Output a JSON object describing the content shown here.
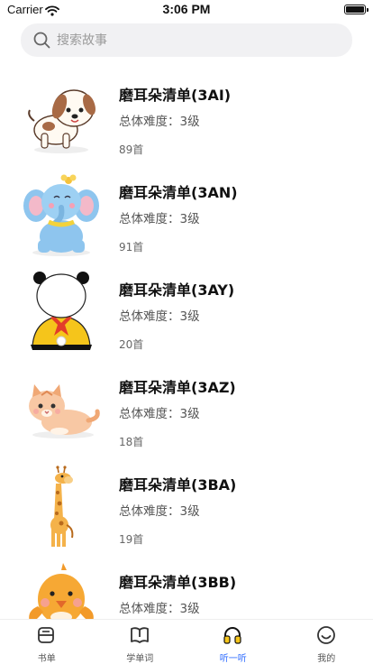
{
  "status_bar": {
    "carrier": "Carrier",
    "time": "3:06 PM"
  },
  "search": {
    "placeholder": "搜索故事",
    "value": ""
  },
  "stories": [
    {
      "title": "磨耳朵清单(3AI)",
      "difficulty": "总体难度：3级",
      "count": "89首",
      "thumbnail": "puppy"
    },
    {
      "title": "磨耳朵清单(3AN)",
      "difficulty": "总体难度：3级",
      "count": "91首",
      "thumbnail": "elephant"
    },
    {
      "title": "磨耳朵清单(3AY)",
      "difficulty": "总体难度：3级",
      "count": "20首",
      "thumbnail": "panda"
    },
    {
      "title": "磨耳朵清单(3AZ)",
      "difficulty": "总体难度：3级",
      "count": "18首",
      "thumbnail": "cat"
    },
    {
      "title": "磨耳朵清单(3BA)",
      "difficulty": "总体难度：3级",
      "count": "19首",
      "thumbnail": "giraffe"
    },
    {
      "title": "磨耳朵清单(3BB)",
      "difficulty": "总体难度：3级",
      "count": "",
      "thumbnail": "bird"
    }
  ],
  "tabs": [
    {
      "label": "书单",
      "icon": "booklist-icon",
      "active": false
    },
    {
      "label": "学单词",
      "icon": "book-icon",
      "active": false
    },
    {
      "label": "听一听",
      "icon": "headphones-icon",
      "active": true
    },
    {
      "label": "我的",
      "icon": "smiley-icon",
      "active": false
    }
  ],
  "colors": {
    "accent": "#2d6bff",
    "search_bg": "#f1f1f3"
  }
}
